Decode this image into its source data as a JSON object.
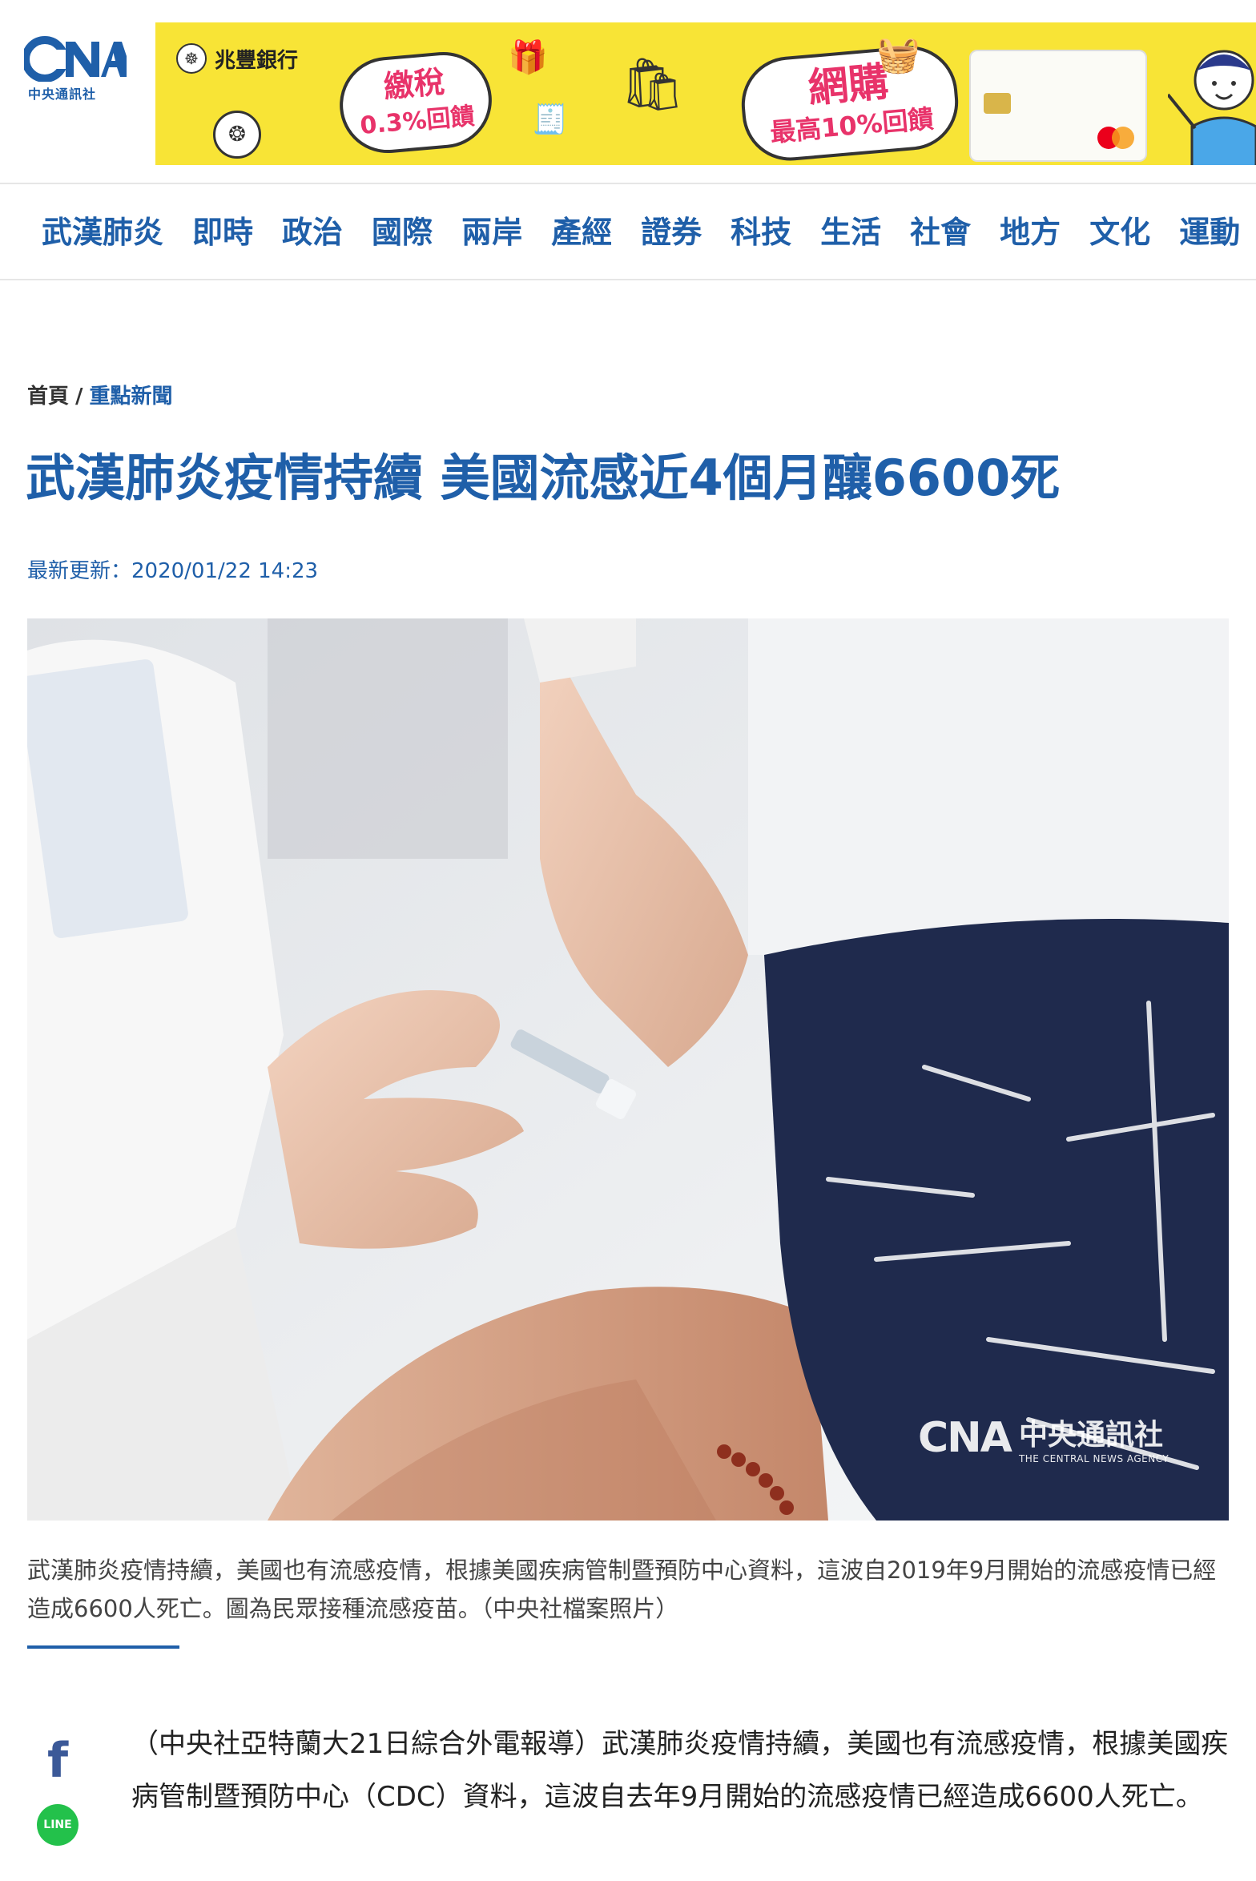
{
  "header": {
    "logo_text": "CNA",
    "logo_subtitle": "中央通訊社"
  },
  "ad": {
    "bank_name": "兆豐銀行",
    "tax_line1": "繳稅",
    "tax_line2": "0.3%回饋",
    "web_line1": "網購",
    "web_line2": "最高10%回饋"
  },
  "nav": {
    "items": [
      "武漢肺炎",
      "即時",
      "政治",
      "國際",
      "兩岸",
      "產經",
      "證券",
      "科技",
      "生活",
      "社會",
      "地方",
      "文化",
      "運動"
    ]
  },
  "breadcrumb": {
    "home": "首頁",
    "separator": "/",
    "current": "重點新聞"
  },
  "article": {
    "title": "武漢肺炎疫情持續 美國流感近4個月釀6600死",
    "updated": "最新更新：2020/01/22 14:23",
    "caption": "武漢肺炎疫情持續，美國也有流感疫情，根據美國疾病管制暨預防中心資料，這波自2019年9月開始的流感疫情已經造成6600人死亡。圖為民眾接種流感疫苗。（中央社檔案照片）",
    "watermark_cn": "中央通訊社",
    "watermark_en": "THE CENTRAL NEWS AGENCY",
    "watermark_logo": "CNA",
    "body": "（中央社亞特蘭大21日綜合外電報導）武漢肺炎疫情持續，美國也有流感疫情，根據美國疾病管制暨預防中心（CDC）資料，這波自去年9月開始的流感疫情已經造成6600人死亡。"
  },
  "share": {
    "facebook_icon": "f",
    "line_label": "LINE"
  },
  "colors": {
    "brand_blue": "#1f5fa9",
    "ad_yellow": "#f8e436",
    "ad_pink": "#e8336a",
    "line_green": "#23c14b",
    "facebook_blue": "#3b5998"
  }
}
